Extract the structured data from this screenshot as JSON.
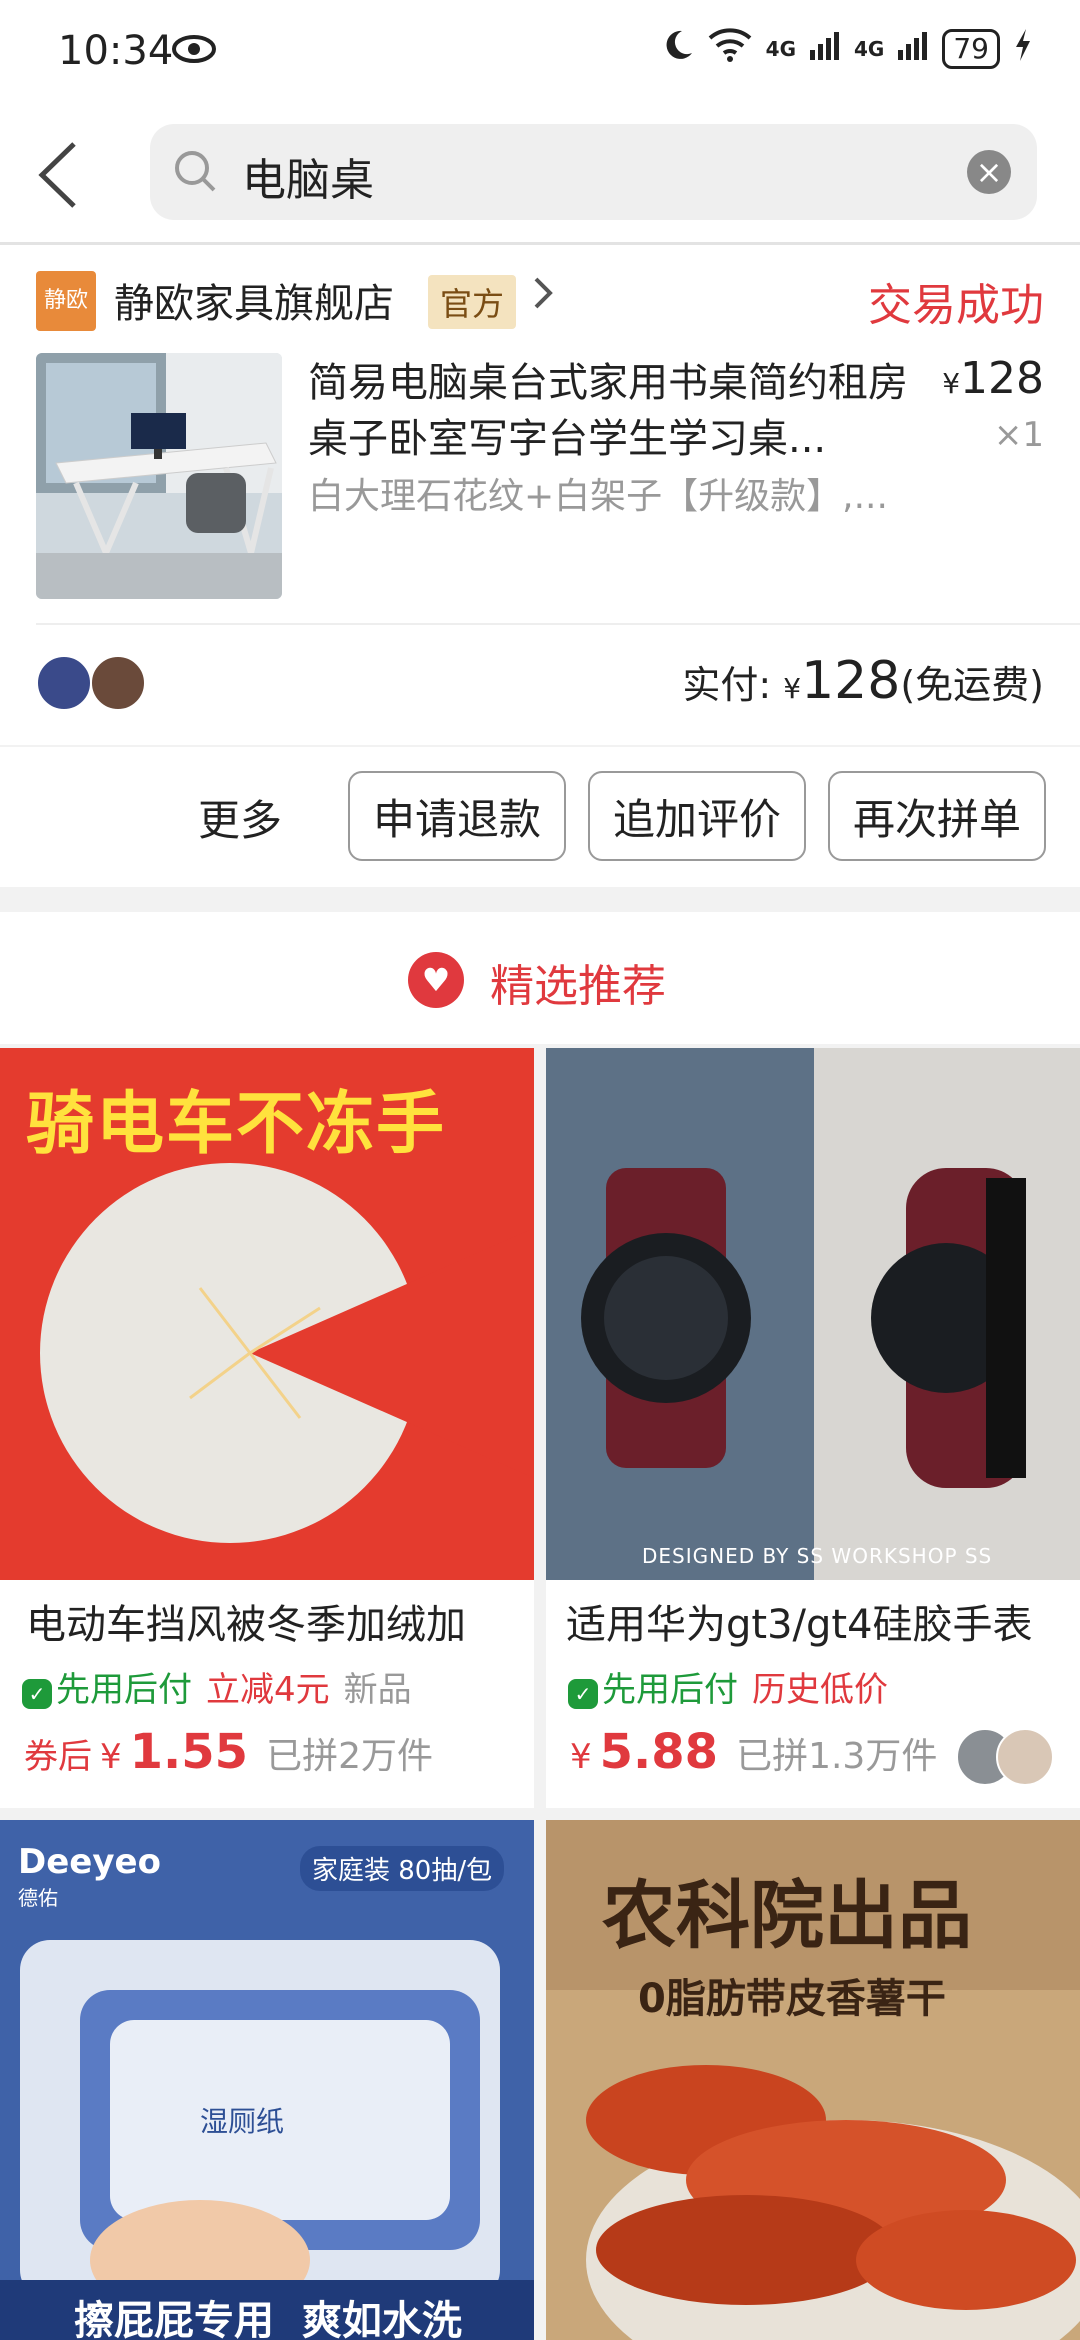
{
  "status_bar": {
    "time": "10:34",
    "signal_a": "4G",
    "signal_b": "4G",
    "battery": "79"
  },
  "search": {
    "query": "电脑桌",
    "icons": [
      "back-icon",
      "search-icon",
      "clear-icon"
    ]
  },
  "order": {
    "store_logo_text": "静欧",
    "store_name": "静欧家具旗舰店",
    "official_badge": "官方",
    "status": "交易成功",
    "product_title": "简易电脑桌台式家用书桌简约租房桌子卧室写字台学生学习桌...",
    "product_spec": "白大理石花纹+白架子【升级款】,...",
    "price_symbol": "¥",
    "price": "128",
    "quantity": "×1",
    "pay_label": "实付:",
    "pay_symbol": "¥",
    "pay_amount": "128",
    "pay_note": "(免运费)"
  },
  "actions": {
    "more": "更多",
    "refund": "申请退款",
    "review": "追加评价",
    "reorder": "再次拼单"
  },
  "recommend": {
    "title": "精选推荐"
  },
  "products": [
    {
      "image_text": "骑电车不冻手",
      "title": "电动车挡风被冬季加绒加",
      "tag1": "先用后付",
      "tag2": "立减4元",
      "tag3": "新品",
      "coupon": "券后",
      "currency": "¥",
      "price": "1.55",
      "sold": "已拼2万件"
    },
    {
      "image_text": "DESIGNED BY SS WORKSHOP SS",
      "title": "适用华为gt3/gt4硅胶手表",
      "tag1": "先用后付",
      "tag2": "历史低价",
      "currency": "¥",
      "price": "5.88",
      "sold": "已拼1.3万件"
    },
    {
      "brand": "Deeyeo",
      "brand_cn": "德佑",
      "badge": "家庭装 80抽/包",
      "pack_label": "湿厕纸",
      "bottom_text": "擦屁屁专用  爽如水洗"
    },
    {
      "headline": "农科院出品",
      "subline": "0脂肪带皮香薯干"
    }
  ],
  "colors": {
    "accent_red": "#e0393e",
    "green": "#1e9a3a",
    "official_bg": "#f4e3bf"
  }
}
